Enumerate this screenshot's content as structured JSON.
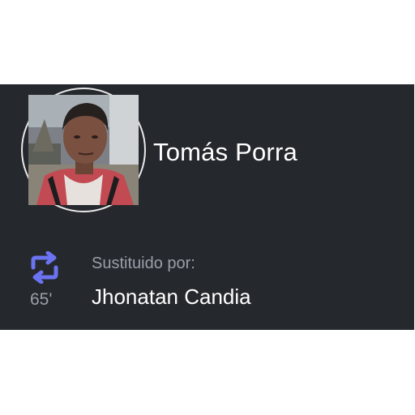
{
  "player": {
    "name": "Tomás Porra"
  },
  "substitution": {
    "label": "Sustituido por:",
    "minute": "65'",
    "replacement": "Jhonatan Candia",
    "icon": "swap-icon"
  },
  "colors": {
    "card_background": "#25282d",
    "accent": "#6b73f0",
    "muted_text": "#9aa0a8",
    "primary_text": "#ffffff"
  }
}
